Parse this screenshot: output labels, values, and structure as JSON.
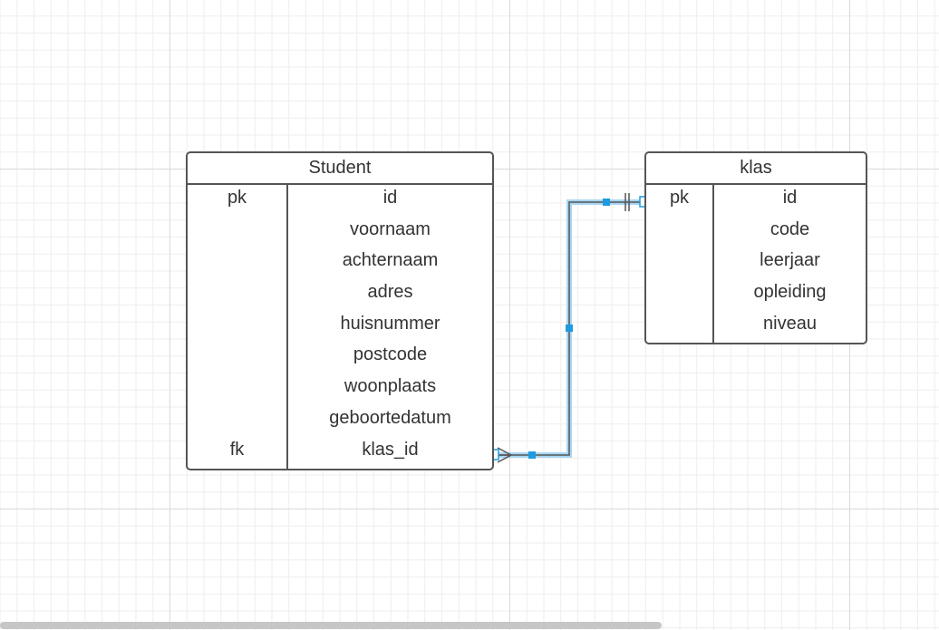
{
  "entities": {
    "student": {
      "title": "Student",
      "keys": [
        "pk",
        "",
        "",
        "",
        "",
        "",
        "",
        "",
        "fk"
      ],
      "fields": [
        "id",
        "voornaam",
        "achternaam",
        "adres",
        "huisnummer",
        "postcode",
        "woonplaats",
        "geboortedatum",
        "klas_id"
      ]
    },
    "klas": {
      "title": "klas",
      "keys": [
        "pk",
        "",
        "",
        "",
        ""
      ],
      "fields": [
        "id",
        "code",
        "leerjaar",
        "opleiding",
        "niveau"
      ]
    }
  },
  "relationship": {
    "from": "Student.klas_id",
    "to": "klas.id",
    "from_end": "many",
    "to_end": "one",
    "color": "#1e9be0"
  },
  "colors": {
    "entity_border": "#555555",
    "text": "#333333",
    "connector": "#1e9be0",
    "grid_major": "#d9d9d9",
    "grid_minor": "#eeeeee"
  }
}
